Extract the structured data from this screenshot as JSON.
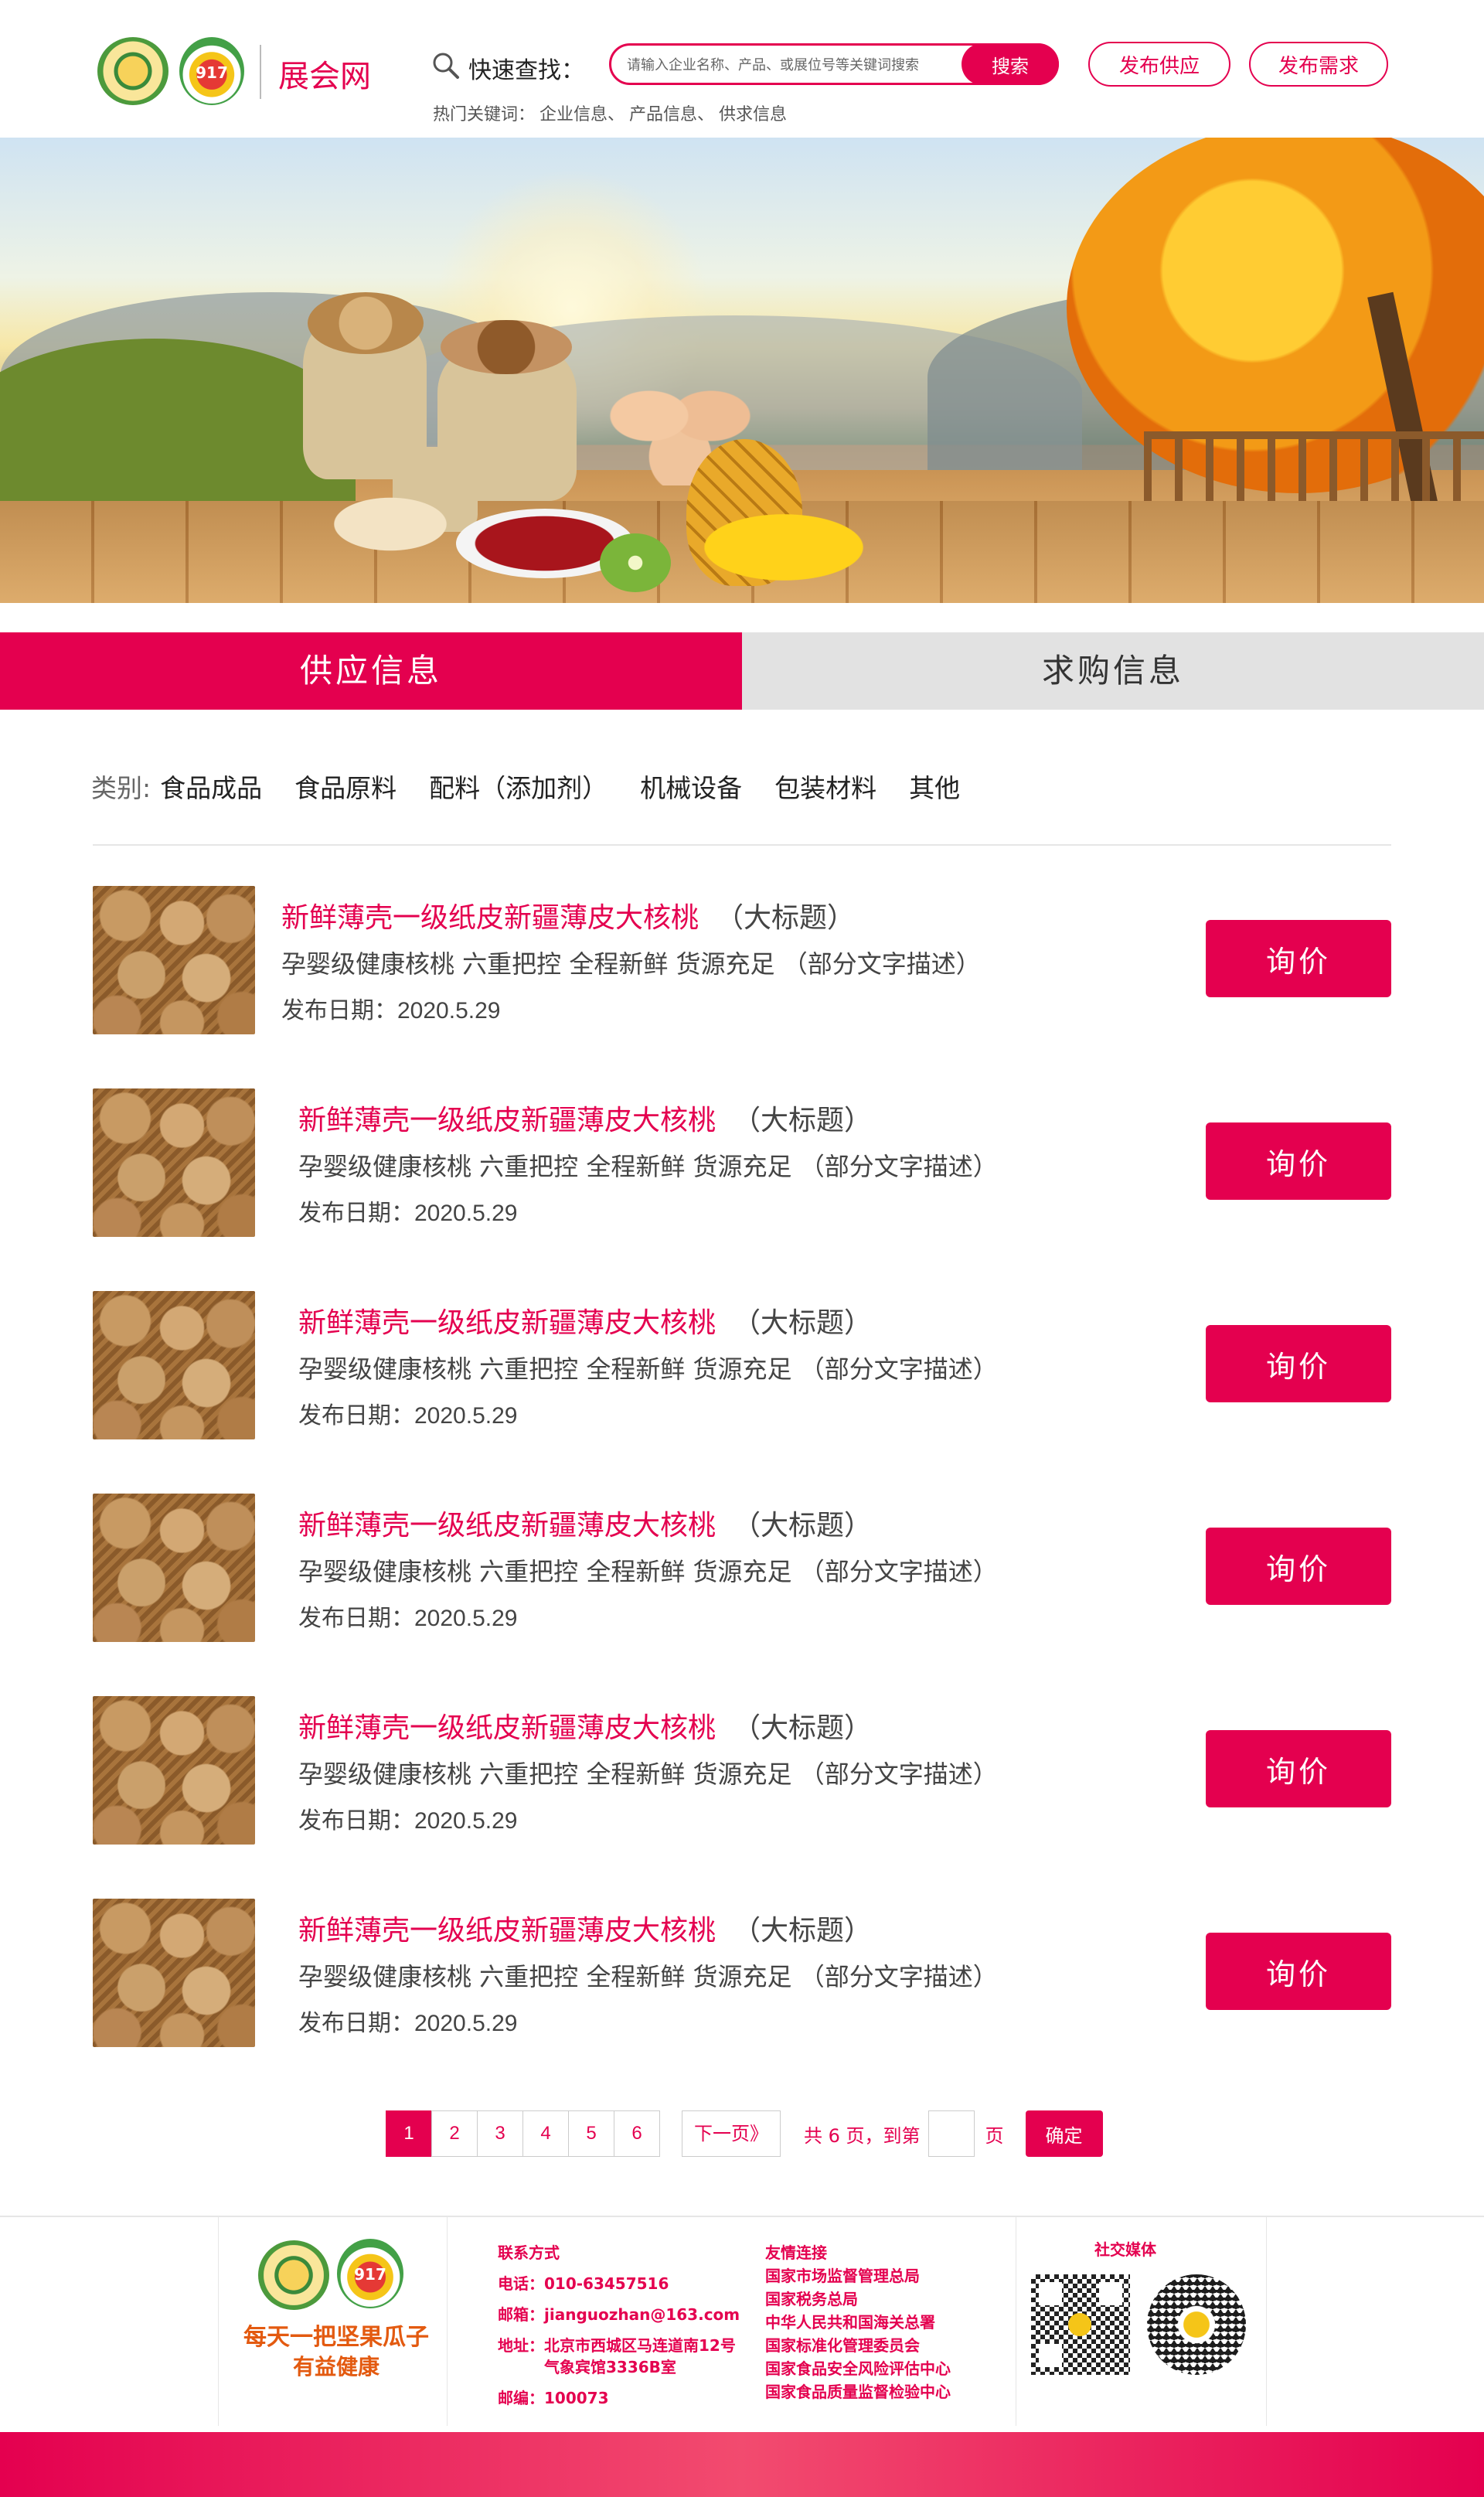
{
  "header": {
    "site_name": "展会网",
    "logo2_text": "917",
    "quick_search_label": "快速查找：",
    "search_placeholder": "请输入企业名称、产品、或展位号等关键词搜索",
    "search_button": "搜索",
    "hot_keywords_label": "热门关键词：",
    "hot_keywords": [
      "企业信息、",
      "产品信息、",
      "供求信息"
    ],
    "publish_supply": "发布供应",
    "publish_demand": "发布需求"
  },
  "tabs": [
    {
      "label": "供应信息",
      "active": true
    },
    {
      "label": "求购信息",
      "active": false
    }
  ],
  "categories": {
    "label": "类别:",
    "items": [
      "食品成品",
      "食品原料",
      "配料（添加剂）",
      "机械设备",
      "包装材料",
      "其他"
    ]
  },
  "listings": [
    {
      "title": "新鲜薄壳一级纸皮新疆薄皮大核桃",
      "tag": "（大标题）",
      "desc": "孕婴级健康核桃 六重把控 全程新鲜 货源充足 （部分文字描述）",
      "date_label": "发布日期：",
      "date": "2020.5.29",
      "button": "询价"
    },
    {
      "title": "新鲜薄壳一级纸皮新疆薄皮大核桃",
      "tag": "（大标题）",
      "desc": "孕婴级健康核桃 六重把控 全程新鲜 货源充足 （部分文字描述）",
      "date_label": "发布日期：",
      "date": "2020.5.29",
      "button": "询价"
    },
    {
      "title": "新鲜薄壳一级纸皮新疆薄皮大核桃",
      "tag": "（大标题）",
      "desc": "孕婴级健康核桃 六重把控 全程新鲜 货源充足 （部分文字描述）",
      "date_label": "发布日期：",
      "date": "2020.5.29",
      "button": "询价"
    },
    {
      "title": "新鲜薄壳一级纸皮新疆薄皮大核桃",
      "tag": "（大标题）",
      "desc": "孕婴级健康核桃 六重把控 全程新鲜 货源充足 （部分文字描述）",
      "date_label": "发布日期：",
      "date": "2020.5.29",
      "button": "询价"
    },
    {
      "title": "新鲜薄壳一级纸皮新疆薄皮大核桃",
      "tag": "（大标题）",
      "desc": "孕婴级健康核桃 六重把控 全程新鲜 货源充足 （部分文字描述）",
      "date_label": "发布日期：",
      "date": "2020.5.29",
      "button": "询价"
    },
    {
      "title": "新鲜薄壳一级纸皮新疆薄皮大核桃",
      "tag": "（大标题）",
      "desc": "孕婴级健康核桃 六重把控 全程新鲜 货源充足 （部分文字描述）",
      "date_label": "发布日期：",
      "date": "2020.5.29",
      "button": "询价"
    }
  ],
  "pagination": {
    "pages": [
      "1",
      "2",
      "3",
      "4",
      "5",
      "6"
    ],
    "current": "1",
    "next_label": "下一页》",
    "total_text": "共 6 页，到第",
    "unit": "页",
    "confirm": "确定"
  },
  "footer": {
    "logo2_text": "917",
    "slogan1": "每天一把坚果瓜子",
    "slogan2": "有益健康",
    "contact_heading": "联系方式",
    "contact_lines": [
      "电话：010-63457516",
      "邮箱：jianguozhan@163.com",
      "地址：北京市西城区马连道南12号",
      "　　　气象宾馆3336B室",
      "邮编：100073"
    ],
    "links_heading": "友情连接",
    "links": [
      "国家市场监督管理总局",
      "国家税务总局",
      "中华人民共和国海关总署",
      "国家标准化管理委员会",
      "国家食品安全风险评估中心",
      "国家食品质量监督检验中心"
    ],
    "social_heading": "社交媒体"
  },
  "colors": {
    "brand": "#e4004f",
    "tab_inactive": "#e2e2e2",
    "slogan": "#e35a10"
  }
}
